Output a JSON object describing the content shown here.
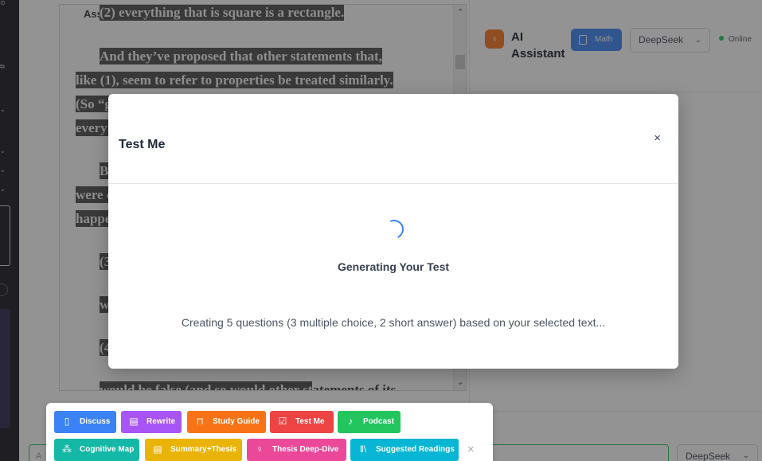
{
  "document": {
    "header_fragment": "Ass",
    "lines": [
      {
        "text": "(2) everything that is square is a rectangle."
      },
      {
        "text": "And they’ve proposed that other statements that,"
      },
      {
        "text": "like (1), seem to refer to properties be treated similarly."
      },
      {
        "text": "(So “gre"
      },
      {
        "text": "everythi"
      },
      {
        "text": "But"
      },
      {
        "text": "were ex"
      },
      {
        "text": "happene"
      },
      {
        "text": "(3) e"
      },
      {
        "text": "woul"
      },
      {
        "text": "(4) s"
      },
      {
        "text": "would be false (and so would other st",
        "tail": "atements of its"
      }
    ]
  },
  "ai_panel": {
    "title": "AI Assistant",
    "mode_button": "Math",
    "model": "DeepSeek",
    "status": "Online",
    "bottom_model": "DeepSeek",
    "input_prefix": "A"
  },
  "modal": {
    "title": "Test Me",
    "close": "×",
    "heading": "Generating Your Test",
    "description": "Creating 5 questions (3 multiple choice, 2 short answer) based on your selected text..."
  },
  "actions": [
    {
      "label": "Discuss",
      "icon": "book-open-icon",
      "glyph": "▯",
      "color": "#3b82f6"
    },
    {
      "label": "Rewrite",
      "icon": "document-icon",
      "glyph": "▤",
      "color": "#a855f7"
    },
    {
      "label": "Study Guide",
      "icon": "bookmark-icon",
      "glyph": "⊓",
      "color": "#f97316"
    },
    {
      "label": "Test Me",
      "icon": "clipboard-check-icon",
      "glyph": "☑",
      "color": "#ef4444"
    },
    {
      "label": "Podcast",
      "icon": "speaker-icon",
      "glyph": "♪",
      "color": "#22c55e"
    },
    {
      "label": "Cognitive Map",
      "icon": "network-icon",
      "glyph": "⁂",
      "color": "#14b8a6"
    },
    {
      "label": "Summary+Thesis",
      "icon": "document-text-icon",
      "glyph": "▤",
      "color": "#eab308"
    },
    {
      "label": "Thesis Deep-Dive",
      "icon": "lightbulb-icon",
      "glyph": "♀",
      "color": "#ec4899"
    },
    {
      "label": "Suggested Readings",
      "icon": "library-icon",
      "glyph": "‖\\",
      "color": "#06b6d4"
    }
  ],
  "action_close": "×",
  "colors": {
    "accent_blue": "#3b82f6",
    "online_green": "#22c55e",
    "overlay": "rgba(40,40,40,0.5)"
  }
}
